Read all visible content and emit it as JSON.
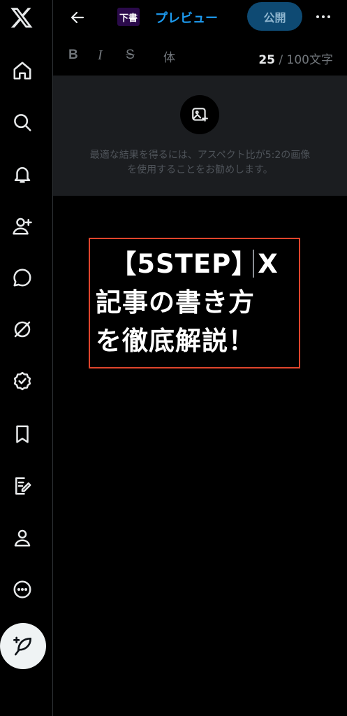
{
  "sidebar": {
    "items": [
      {
        "name": "home",
        "icon": "home-icon"
      },
      {
        "name": "explore",
        "icon": "search-icon"
      },
      {
        "name": "notifications",
        "icon": "bell-icon"
      },
      {
        "name": "follow",
        "icon": "add-person-icon"
      },
      {
        "name": "chat",
        "icon": "chat-bubble-icon"
      },
      {
        "name": "grok",
        "icon": "grok-icon"
      },
      {
        "name": "verified",
        "icon": "verified-badge-icon"
      },
      {
        "name": "bookmarks",
        "icon": "bookmark-icon"
      },
      {
        "name": "articles",
        "icon": "article-edit-icon"
      },
      {
        "name": "profile",
        "icon": "person-icon"
      },
      {
        "name": "more",
        "icon": "more-circle-icon"
      }
    ]
  },
  "topbar": {
    "draft_thumb": "下書",
    "preview_label": "プレビュー",
    "publish_label": "公開"
  },
  "toolbar": {
    "bold": "B",
    "italic": "I",
    "strike": "S",
    "body_style": "体",
    "char_count_current": "25",
    "char_count_rest": " / 100文字"
  },
  "header_image": {
    "hint_line1": "最適な結果を得るには、アスペクト比が5:2の画像",
    "hint_line2": "を使用することをお勧めします。"
  },
  "title": {
    "line1": "【5STEP】X",
    "line2": "記事の書き方",
    "line3": "を徹底解説！"
  },
  "colors": {
    "accent": "#1d9bf0",
    "publish_bg": "#0e4a73",
    "title_border": "#e0452c",
    "background": "#000000"
  }
}
